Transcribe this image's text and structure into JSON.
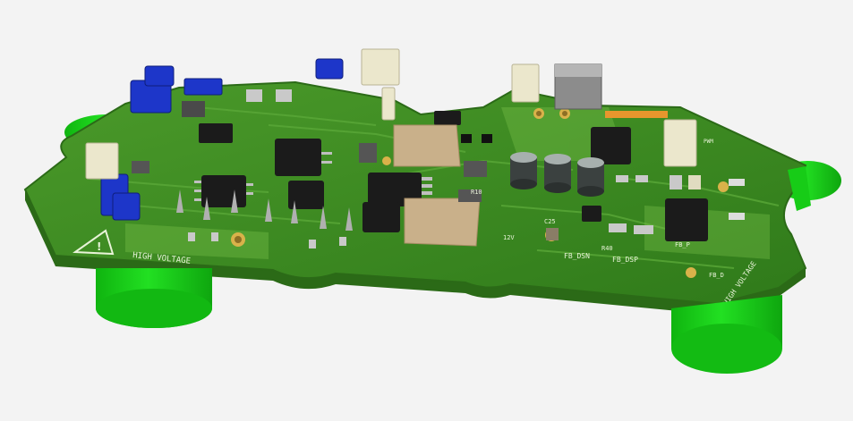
{
  "view": {
    "background": "#f3f3f3"
  },
  "board": {
    "pcb_color": "#3f8a22",
    "pcb_edge_color": "#2b6a17",
    "silkscreen_color": "#e8f3d8",
    "standoff_color": "#19d419",
    "gold_color": "#d9b24a",
    "ic_color": "#1b1b1b",
    "connector_blue": "#1d36c9",
    "connector_white": "#ebe7cc",
    "inductor_color": "#c9b08a"
  },
  "silkscreen": {
    "warning_left": "HIGH VOLTAGE",
    "warning_right": "HIGH VOLTAGE",
    "labels": [
      "FB_DSN",
      "FB_DSP",
      "FB_P",
      "R40",
      "C25",
      "R10",
      "12V",
      "PWM",
      "FB_D"
    ]
  }
}
